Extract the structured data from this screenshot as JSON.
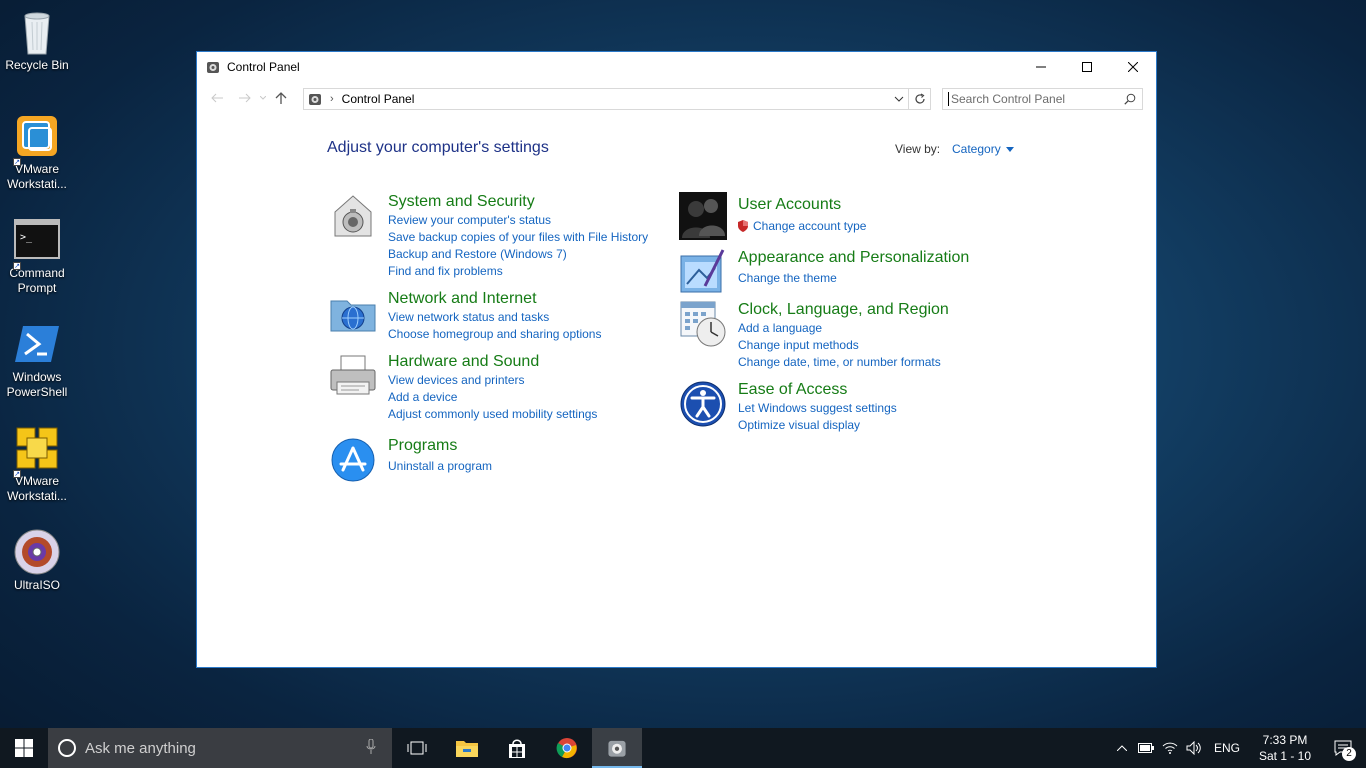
{
  "desktop": {
    "icons": [
      {
        "label": "Recycle Bin",
        "icon": "recycle-bin-icon"
      },
      {
        "label": "VMware Workstati...",
        "icon": "vmware-icon"
      },
      {
        "label": "Command Prompt",
        "icon": "command-prompt-icon"
      },
      {
        "label": "Windows PowerShell",
        "icon": "powershell-icon"
      },
      {
        "label": "VMware Workstati...",
        "icon": "vmware-player-icon"
      },
      {
        "label": "UltraISO",
        "icon": "ultraiso-icon"
      }
    ]
  },
  "window": {
    "title": "Control Panel",
    "address": {
      "crumb": "Control Panel"
    },
    "search": {
      "placeholder": "Search Control Panel"
    },
    "page_title": "Adjust your computer's settings",
    "view_by": {
      "label": "View by:",
      "value": "Category"
    },
    "categories_left": [
      {
        "title": "System and Security",
        "icon": "system-security-icon",
        "links": [
          "Review your computer's status",
          "Save backup copies of your files with File History",
          "Backup and Restore (Windows 7)",
          "Find and fix problems"
        ]
      },
      {
        "title": "Network and Internet",
        "icon": "network-internet-icon",
        "links": [
          "View network status and tasks",
          "Choose homegroup and sharing options"
        ]
      },
      {
        "title": "Hardware and Sound",
        "icon": "hardware-sound-icon",
        "links": [
          "View devices and printers",
          "Add a device",
          "Adjust commonly used mobility settings"
        ]
      },
      {
        "title": "Programs",
        "icon": "programs-icon",
        "links": [
          "Uninstall a program"
        ]
      }
    ],
    "categories_right": [
      {
        "title": "User Accounts",
        "icon": "user-accounts-icon",
        "links": [
          "Change account type"
        ]
      },
      {
        "title": "Appearance and Personalization",
        "icon": "appearance-icon",
        "links": [
          "Change the theme"
        ]
      },
      {
        "title": "Clock, Language, and Region",
        "icon": "clock-language-icon",
        "links": [
          "Add a language",
          "Change input methods",
          "Change date, time, or number formats"
        ]
      },
      {
        "title": "Ease of Access",
        "icon": "ease-of-access-icon",
        "links": [
          "Let Windows suggest settings",
          "Optimize visual display"
        ]
      }
    ]
  },
  "taskbar": {
    "search_placeholder": "Ask me anything",
    "tray": {
      "language": "ENG",
      "time": "7:33 PM",
      "date": "Sat 1 - 10",
      "notification_count": "2"
    }
  },
  "colors": {
    "link": "#1565c0",
    "category_title": "#167c16",
    "page_title": "#1e3287",
    "taskbar": "#101820"
  }
}
